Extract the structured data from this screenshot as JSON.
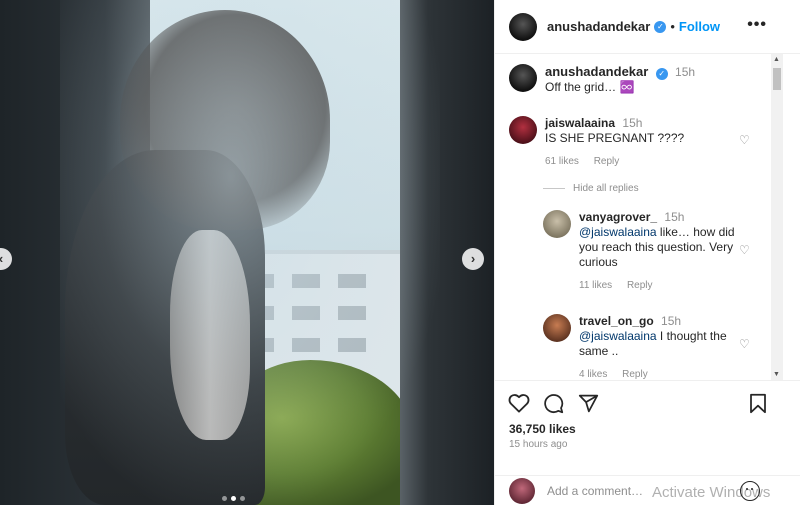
{
  "post": {
    "author": "anushadandekar",
    "follow_label": "Follow",
    "separator": "•",
    "more_label": "•••",
    "verified_mark": "✓",
    "media": {
      "prev_arrow": "‹",
      "next_arrow": "›",
      "slide_count": 3,
      "active_slide": 2
    }
  },
  "caption": {
    "username": "anushadandekar",
    "time": "15h",
    "text": "Off the grid… ♾️"
  },
  "comments": [
    {
      "username": "jaiswalaaina",
      "time": "15h",
      "text": "IS SHE PREGNANT ????",
      "likes": "61 likes",
      "reply_label": "Reply"
    }
  ],
  "hide_replies_label": "Hide all replies",
  "replies": [
    {
      "username": "vanyagrover_",
      "time": "15h",
      "mention": "@jaiswalaaina",
      "text": " like… how did you reach this question. Very curious",
      "likes": "11 likes",
      "reply_label": "Reply"
    },
    {
      "username": "travel_on_go",
      "time": "15h",
      "mention": "@jaiswalaaina",
      "text": " I thought the same ..",
      "likes": "4 likes",
      "reply_label": "Reply"
    }
  ],
  "stats": {
    "likes": "36,750 likes",
    "posted": "15 hours ago"
  },
  "add_comment": {
    "placeholder": "Add a comment…"
  },
  "watermark": "Activate Windows",
  "icons": {
    "heart": "heart-icon",
    "comment": "comment-icon",
    "share": "share-icon",
    "save": "bookmark-icon",
    "emoji": "emoji-icon"
  },
  "colors": {
    "accent": "#0095f6",
    "verified": "#3897f0",
    "muted": "#8e8e8e"
  }
}
